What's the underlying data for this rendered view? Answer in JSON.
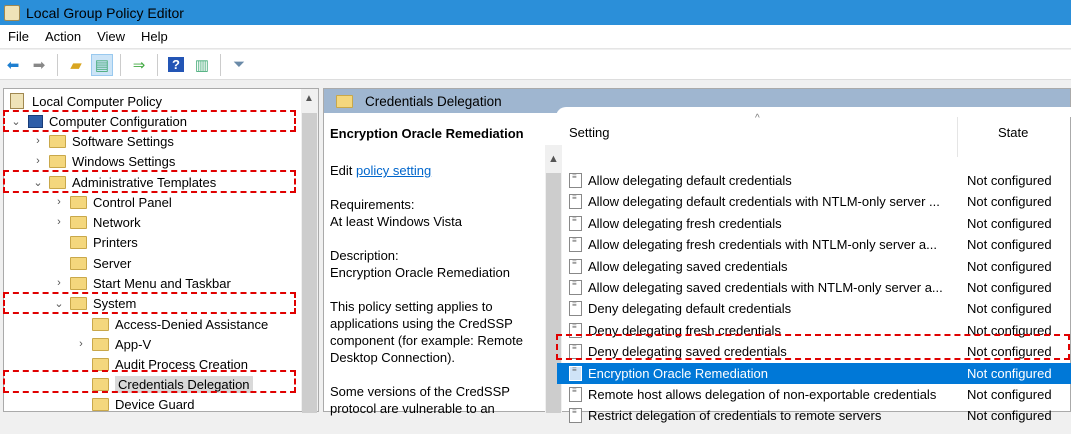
{
  "window": {
    "title": "Local Group Policy Editor"
  },
  "menu": [
    "File",
    "Action",
    "View",
    "Help"
  ],
  "toolbar": [
    "back-icon",
    "forward-icon",
    "up-folder-icon",
    "show-hide-tree-icon",
    "export-list-icon",
    "help-icon",
    "show-hide-action-pane-icon",
    "filter-icon"
  ],
  "tree": {
    "root": "Local Computer Policy",
    "computer_config": "Computer Configuration",
    "software_settings": "Software Settings",
    "windows_settings": "Windows Settings",
    "admin_templates": "Administrative Templates",
    "control_panel": "Control Panel",
    "network": "Network",
    "printers": "Printers",
    "server": "Server",
    "start_menu": "Start Menu and Taskbar",
    "system": "System",
    "access_denied": "Access-Denied Assistance",
    "app_v": "App-V",
    "audit_process": "Audit Process Creation",
    "credentials_delegation": "Credentials Delegation",
    "device_guard": "Device Guard"
  },
  "panel": {
    "header": "Credentials Delegation",
    "desc_title": "Encryption Oracle Remediation",
    "edit_prefix": "Edit",
    "edit_link": "policy setting",
    "requirements_label": "Requirements:",
    "requirements": "At least Windows Vista",
    "description_label": "Description:",
    "description": "Encryption Oracle Remediation",
    "para1": "This policy setting applies to applications using the CredSSP component (for example: Remote Desktop Connection).",
    "para2": "Some versions of the CredSSP protocol are vulnerable to an"
  },
  "list": {
    "col_setting": "Setting",
    "col_state": "State",
    "rows": [
      {
        "name": "Allow delegating default credentials",
        "state": "Not configured"
      },
      {
        "name": "Allow delegating default credentials with NTLM-only server ...",
        "state": "Not configured"
      },
      {
        "name": "Allow delegating fresh credentials",
        "state": "Not configured"
      },
      {
        "name": "Allow delegating fresh credentials with NTLM-only server a...",
        "state": "Not configured"
      },
      {
        "name": "Allow delegating saved credentials",
        "state": "Not configured"
      },
      {
        "name": "Allow delegating saved credentials with NTLM-only server a...",
        "state": "Not configured"
      },
      {
        "name": "Deny delegating default credentials",
        "state": "Not configured"
      },
      {
        "name": "Deny delegating fresh credentials",
        "state": "Not configured"
      },
      {
        "name": "Deny delegating saved credentials",
        "state": "Not configured"
      },
      {
        "name": "Encryption Oracle Remediation",
        "state": "Not configured"
      },
      {
        "name": "Remote host allows delegation of non-exportable credentials",
        "state": "Not configured"
      },
      {
        "name": "Restrict delegation of credentials to remote servers",
        "state": "Not configured"
      }
    ]
  },
  "colors": {
    "titlebar": "#2b8fd9",
    "selection": "#0078d7",
    "highlight": "#e00000"
  }
}
